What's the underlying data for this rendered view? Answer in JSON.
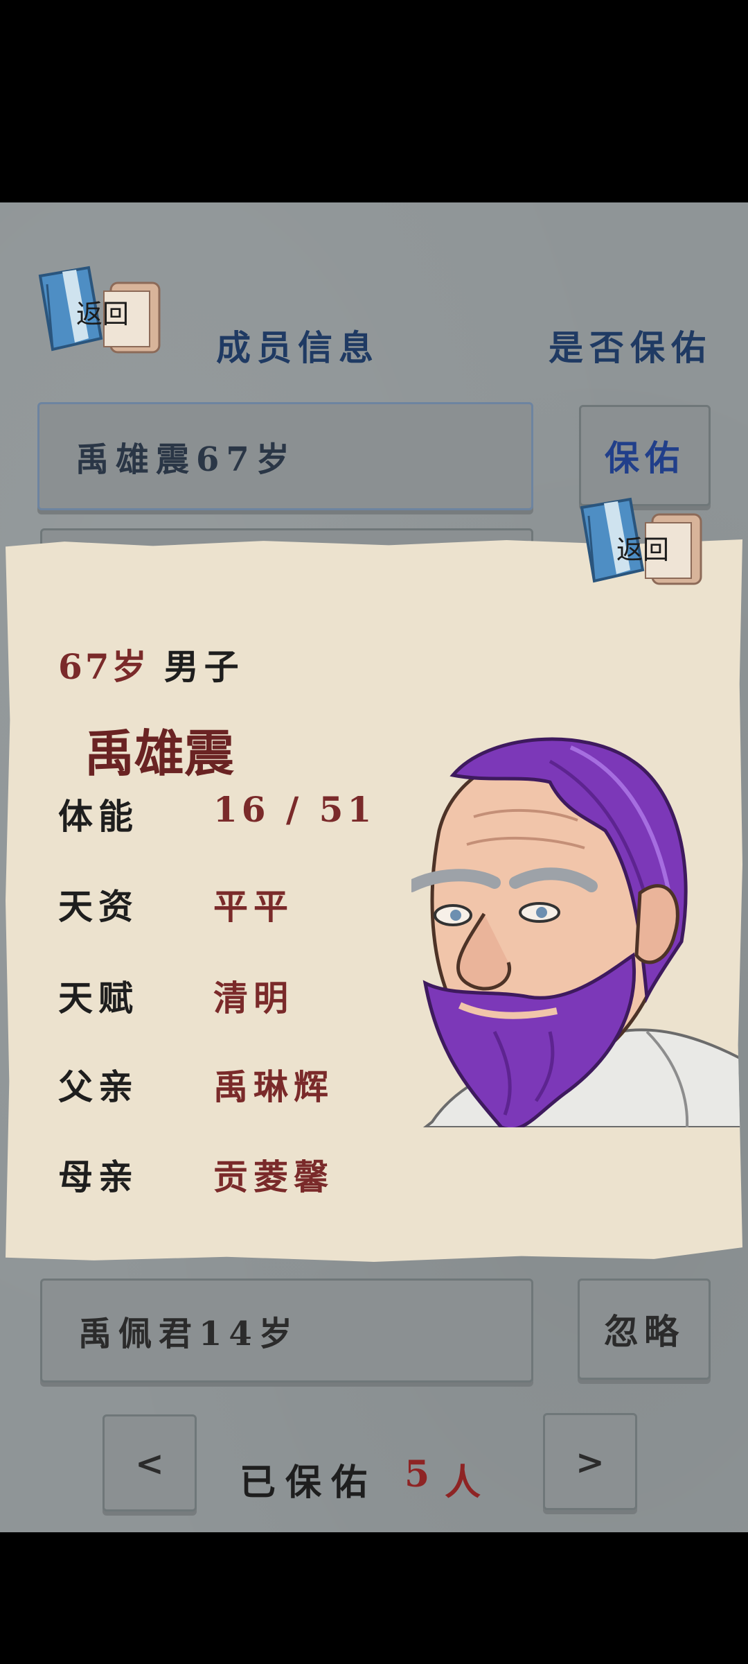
{
  "header": {
    "back_label": "返回",
    "member_info_title": "成员信息",
    "bless_question": "是否保佑"
  },
  "rows": [
    {
      "name": "禹雄震67岁",
      "action": "保佑"
    },
    {
      "name": "禹佩君14岁",
      "action": "忽略"
    }
  ],
  "card": {
    "back_label": "返回",
    "age": "67岁",
    "gender": "男子",
    "name": "禹雄震",
    "stats": [
      {
        "label": "体能",
        "value": "16 / 51"
      },
      {
        "label": "天资",
        "value": "平平"
      },
      {
        "label": "天赋",
        "value": "清明"
      },
      {
        "label": "父亲",
        "value": "禹琳辉"
      },
      {
        "label": "母亲",
        "value": "贡菱馨"
      }
    ],
    "portrait": "old-man-purple-hair-portrait"
  },
  "footer": {
    "prev": "<",
    "next": ">",
    "blessed_label": "已保佑",
    "blessed_count": "5",
    "blessed_unit": "人"
  },
  "colors": {
    "background": "#8f9597",
    "card": "#ece2ce",
    "header_blue": "#1f3a63",
    "value_red": "#7a2a2a",
    "count_red": "#8e2424",
    "hair_purple": "#7c38b8"
  }
}
